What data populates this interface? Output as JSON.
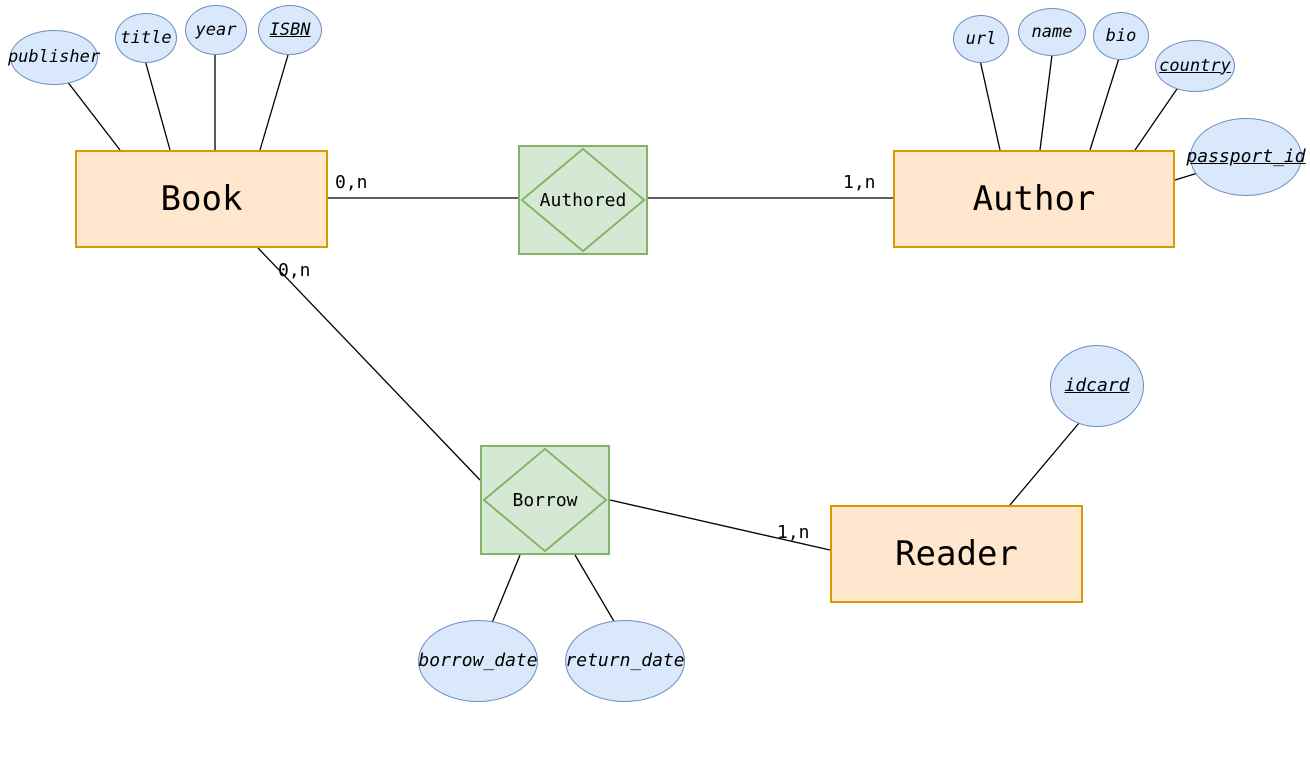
{
  "entities": {
    "book": {
      "label": "Book"
    },
    "author": {
      "label": "Author"
    },
    "reader": {
      "label": "Reader"
    }
  },
  "relationships": {
    "authored": {
      "label": "Authored"
    },
    "borrow": {
      "label": "Borrow"
    }
  },
  "attributes": {
    "publisher": {
      "label": "publisher",
      "key": false
    },
    "title": {
      "label": "title",
      "key": false
    },
    "year": {
      "label": "year",
      "key": false
    },
    "isbn": {
      "label": "ISBN",
      "key": true
    },
    "url": {
      "label": "url",
      "key": false
    },
    "name": {
      "label": "name",
      "key": false
    },
    "bio": {
      "label": "bio",
      "key": false
    },
    "country": {
      "label": "country",
      "key": true
    },
    "passport_id": {
      "label": "passport_id",
      "key": true
    },
    "idcard": {
      "label": "idcard",
      "key": true
    },
    "borrow_date": {
      "label": "borrow_date",
      "key": false
    },
    "return_date": {
      "label": "return_date",
      "key": false
    }
  },
  "cardinalities": {
    "book_authored": "0,n",
    "author_authored": "1,n",
    "book_borrow": "0,n",
    "reader_borrow": "1,n"
  },
  "meta": {
    "diagram_type": "Entity-Relationship (Chen notation)",
    "colors": {
      "entity_fill": "#ffe6cc",
      "entity_stroke": "#d79b00",
      "attr_fill": "#dae8fc",
      "attr_stroke": "#6c8ebf",
      "rel_fill": "#d5e8d4",
      "rel_stroke": "#82b366"
    }
  }
}
